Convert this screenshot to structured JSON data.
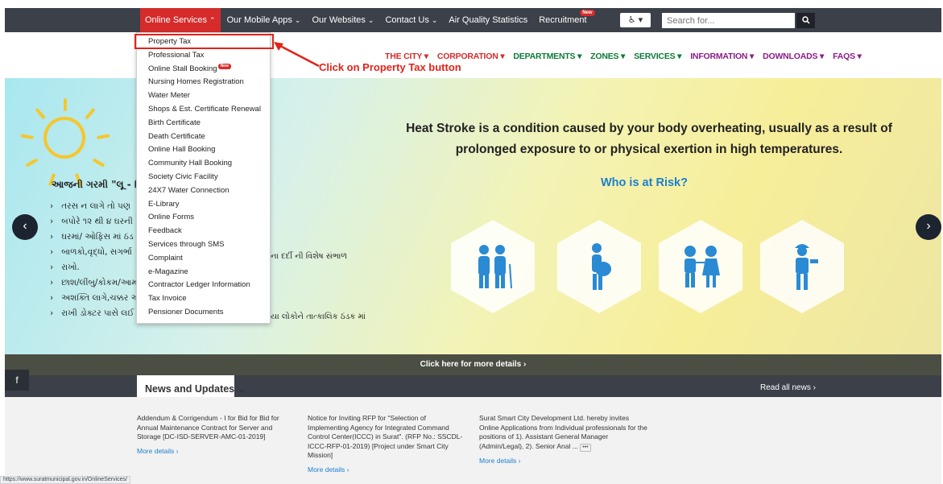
{
  "topnav": {
    "items": [
      {
        "label": "Online Services"
      },
      {
        "label": "Our Mobile Apps"
      },
      {
        "label": "Our Websites"
      },
      {
        "label": "Contact Us"
      },
      {
        "label": "Air Quality Statistics"
      },
      {
        "label": "Recruitment"
      }
    ],
    "new_badge": "New",
    "search_placeholder": "Search for..."
  },
  "secnav": {
    "items": [
      {
        "label": "THE CITY ▾",
        "color": "#d62b2b"
      },
      {
        "label": "CORPORATION ▾",
        "color": "#d62b2b"
      },
      {
        "label": "DEPARTMENTS ▾",
        "color": "#0c7a3a"
      },
      {
        "label": "ZONES ▾",
        "color": "#0c7a3a"
      },
      {
        "label": "SERVICES ▾",
        "color": "#0c7a3a"
      },
      {
        "label": "INFORMATION ▾",
        "color": "#8a1c8a"
      },
      {
        "label": "DOWNLOADS ▾",
        "color": "#8a1c8a"
      },
      {
        "label": "FAQS ▾",
        "color": "#8a1c8a"
      }
    ]
  },
  "dropdown": {
    "items": [
      "Property Tax",
      "Professional Tax",
      "Online Stall Booking",
      "Nursing Homes Registration",
      "Water Meter",
      "Shops & Est. Certificate Renewal",
      "Birth Certificate",
      "Death Certificate",
      "Online Hall Booking",
      "Community Hall Booking",
      "Society Civic Facility",
      "24X7 Water Connection",
      "E-Library",
      "Online Forms",
      "Feedback",
      "Services through SMS",
      "Complaint",
      "e-Magazine",
      "Contractor Ledger Information",
      "Tax Invoice",
      "Pensioner Documents"
    ],
    "new_badge": "New"
  },
  "annotation": "Click on Property Tax button",
  "hero": {
    "heading": "Heat Stroke is a condition caused by your body overheating, usually as a result of prolonged exposure to or physical exertion in high temperatures.",
    "subheading": "Who is at Risk?",
    "guj_title": "આજની ગરમી \"લૂ - હિટવે",
    "guj_lines": [
      "તરસ ન લાગે તો પણ",
      "બપોરે ૧૨ થી ૪ ઘરની",
      "ઘરમાં/ ઓફિસ માં ઠંડ",
      "બાળકો,વૃદ્ધો, સગર્ભા",
      "રાખો.",
      "છાશ/લીંબુ/કોકમ/આમ",
      "અશક્તિ લાગે,ચક્કર આ",
      "રાખી ડોક્ટર પાસે લઈ"
    ],
    "guj_right_1": "ના દર્દી ની વિશેષ સંભાળ",
    "guj_right_2": "યા લોકોને તાત્કાલિક ઠંડક માં"
  },
  "details_bar": "Click here for more details ›",
  "news": {
    "tab": "News and Updates",
    "read_all": "Read all news ›",
    "items": [
      {
        "text": "Addendum & Corrigendum - I for Bid for Bid for Annual Maintenance Contract for Server and Storage [DC-ISD-SERVER-AMC-01-2019]",
        "more": "More details ›"
      },
      {
        "text": "Notice for Inviting RFP for \"Selection of Implementing Agency for Integrated Command Control Center(ICCC) in Surat\". (RFP No.: SSCDL-ICCC-RFP-01-2019) [Project under Smart City Mission]",
        "more": "More details ›"
      },
      {
        "text": "Surat Smart City Development Ltd. hereby invites Online Applications from Individual professionals for the positions of 1). Assistant General Manager (Admin/Legal), 2). Senior Anal ...",
        "more": "More details ›"
      }
    ]
  },
  "status_url": "https://www.suratmunicipal.gov.in/OnlineServices/"
}
